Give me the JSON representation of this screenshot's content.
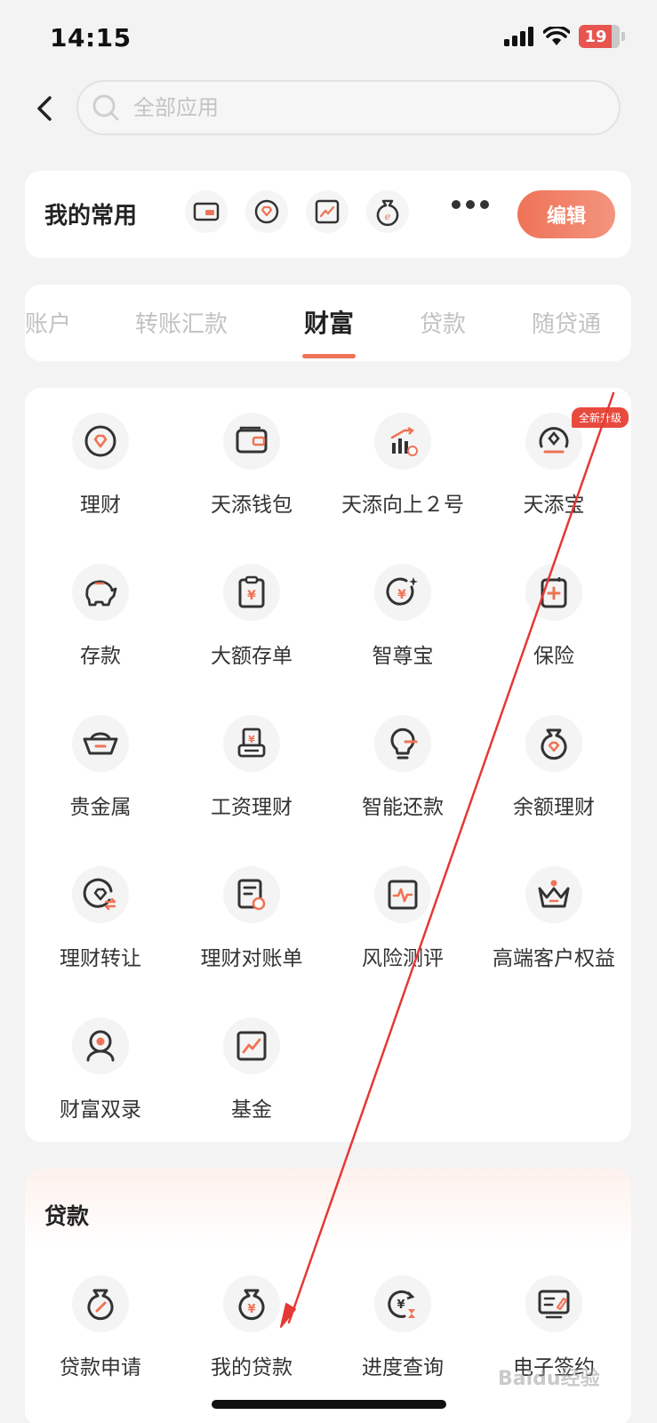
{
  "status_bar": {
    "time": "14:15",
    "battery": "19"
  },
  "search": {
    "placeholder": "全部应用"
  },
  "favorites": {
    "title": "我的常用",
    "icons": [
      "card-icon",
      "diamond-icon",
      "chart-icon",
      "money-bag-icon"
    ],
    "edit_label": "编辑"
  },
  "tabs": [
    {
      "label": "账户"
    },
    {
      "label": "转账汇款"
    },
    {
      "label": "财富",
      "active": true
    },
    {
      "label": "贷款"
    },
    {
      "label": "随贷通"
    }
  ],
  "wealth_items": [
    {
      "label": "理财",
      "icon": "diamond-icon"
    },
    {
      "label": "天添钱包",
      "icon": "wallet-icon"
    },
    {
      "label": "天添向上２号",
      "icon": "rising-bars-icon"
    },
    {
      "label": "天添宝",
      "icon": "gauge-icon",
      "badge": "全新升级"
    },
    {
      "label": "存款",
      "icon": "piggy-bank-icon"
    },
    {
      "label": "大额存单",
      "icon": "clipboard-yuan-icon"
    },
    {
      "label": "智尊宝",
      "icon": "sparkle-yuan-icon"
    },
    {
      "label": "保险",
      "icon": "insurance-icon"
    },
    {
      "label": "贵金属",
      "icon": "gold-ingot-icon"
    },
    {
      "label": "工资理财",
      "icon": "salary-icon"
    },
    {
      "label": "智能还款",
      "icon": "bulb-icon"
    },
    {
      "label": "余额理财",
      "icon": "balance-bag-icon"
    },
    {
      "label": "理财转让",
      "icon": "transfer-icon"
    },
    {
      "label": "理财对账单",
      "icon": "statement-icon"
    },
    {
      "label": "风险测评",
      "icon": "risk-pulse-icon"
    },
    {
      "label": "高端客户权益",
      "icon": "crown-icon"
    },
    {
      "label": "财富双录",
      "icon": "recording-person-icon"
    },
    {
      "label": "基金",
      "icon": "fund-chart-icon"
    }
  ],
  "loans": {
    "title": "贷款",
    "items": [
      {
        "label": "贷款申请",
        "icon": "loan-apply-icon"
      },
      {
        "label": "我的贷款",
        "icon": "my-loan-icon"
      },
      {
        "label": "进度查询",
        "icon": "progress-icon"
      },
      {
        "label": "电子签约",
        "icon": "e-sign-icon"
      }
    ]
  },
  "watermark": "Baidu经验",
  "colors": {
    "accent": "#ef7356",
    "badge": "#e84a3e",
    "annotation_arrow": "#e53935"
  }
}
